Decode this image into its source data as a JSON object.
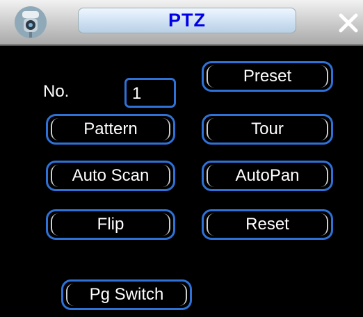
{
  "window": {
    "title": "PTZ"
  },
  "icons": {
    "title": "camera-icon",
    "close": "close-icon"
  },
  "form": {
    "no_label": "No.",
    "no_value": "1"
  },
  "buttons": {
    "preset": "Preset",
    "pattern": "Pattern",
    "tour": "Tour",
    "auto_scan": "Auto Scan",
    "autopan": "AutoPan",
    "flip": "Flip",
    "reset": "Reset",
    "pg_switch": "Pg Switch"
  },
  "colors": {
    "accent": "#2e72d8",
    "title_text": "#0000e6",
    "background": "#000000"
  }
}
